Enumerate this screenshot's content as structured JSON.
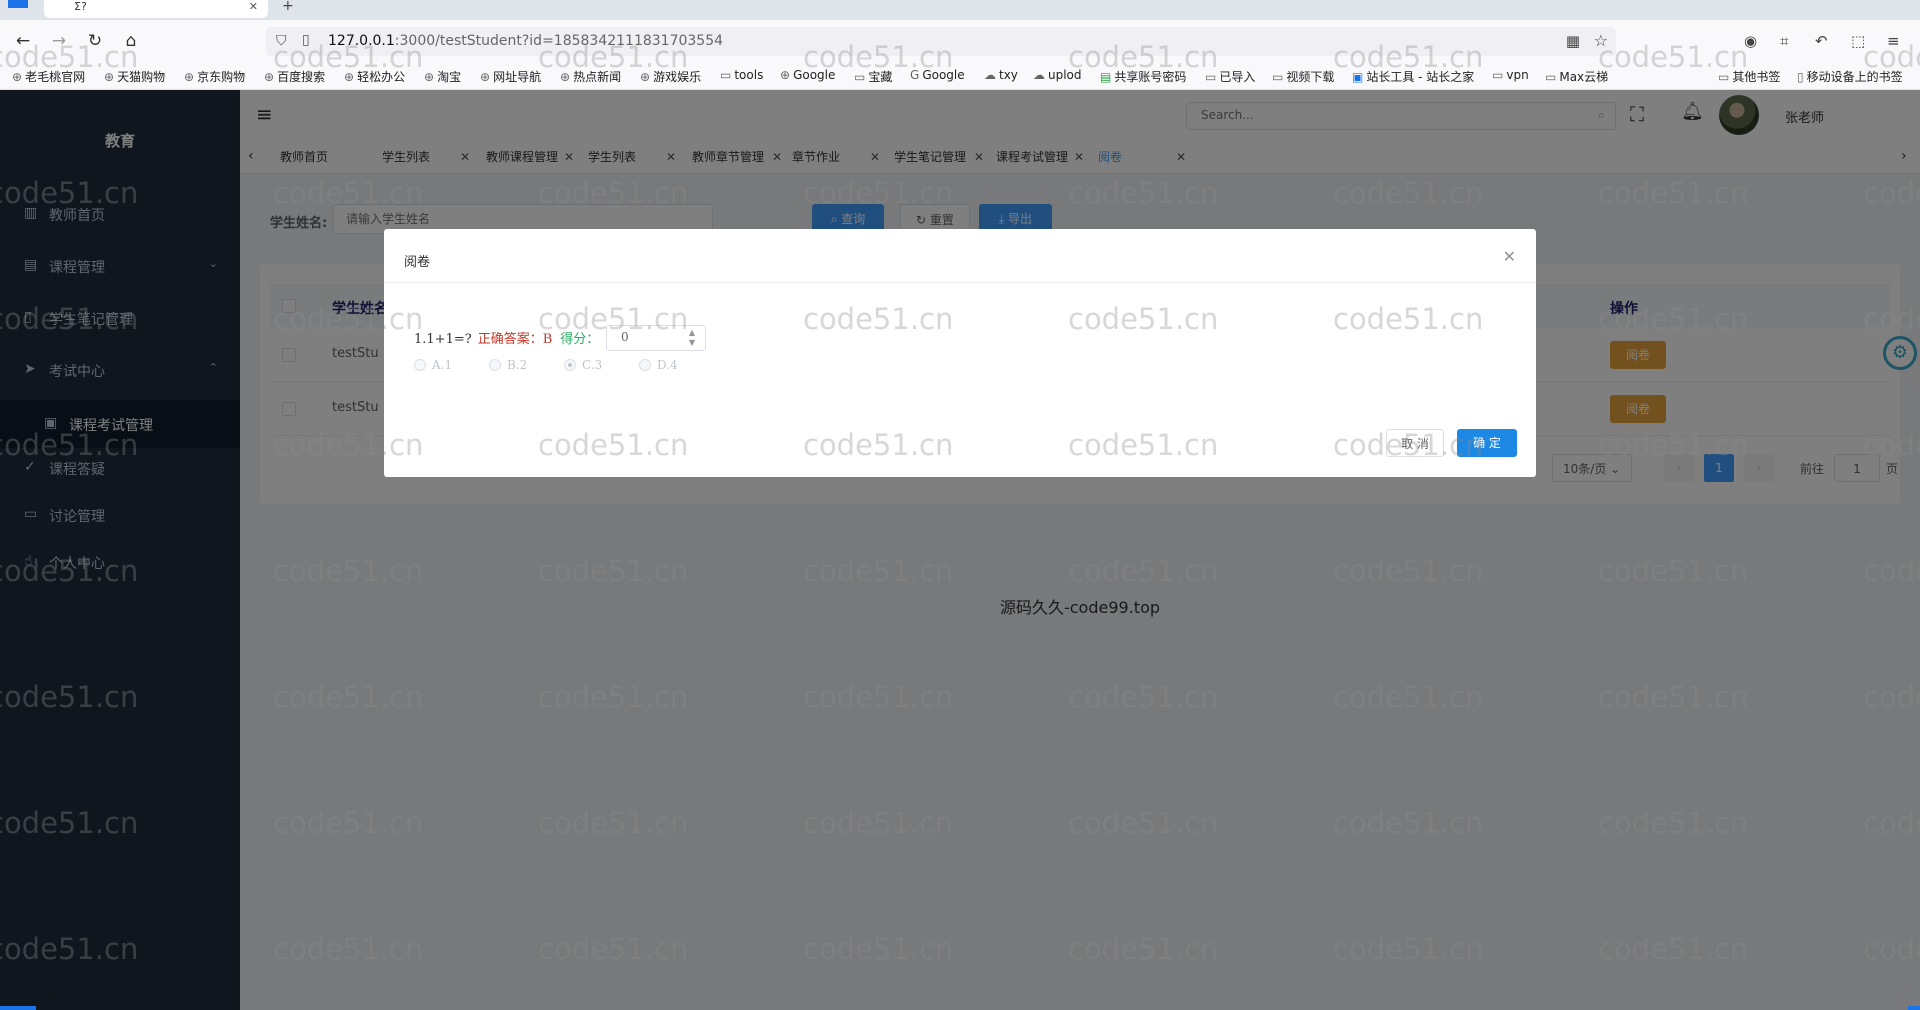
{
  "browser": {
    "tab_title": "Σ?",
    "url_host": "127.0.0.1",
    "url_path": ":3000/testStudent?id=1858342111831703554",
    "bookmarks": [
      "老毛桃官网",
      "天猫购物",
      "京东购物",
      "百度搜索",
      "轻松办公",
      "淘宝",
      "网址导航",
      "热点新闻",
      "游戏娱乐",
      "tools",
      "Google",
      "宝藏",
      "Google",
      "txy",
      "uplod",
      "共享账号密码",
      "已导入",
      "视频下载",
      "站长工具 - 站长之家",
      "vpn",
      "Max云梯",
      "其他书签",
      "移动设备上的书签"
    ]
  },
  "sidebar": {
    "brand": "教育",
    "items": [
      {
        "label": "教师首页"
      },
      {
        "label": "课程管理"
      },
      {
        "label": "学生笔记管理"
      },
      {
        "label": "考试中心"
      },
      {
        "label": "课程考试管理"
      },
      {
        "label": "课程答疑"
      },
      {
        "label": "讨论管理"
      },
      {
        "label": "个人中心"
      }
    ]
  },
  "topbar": {
    "search_placeholder": "Search...",
    "username": "张老师"
  },
  "tags": [
    "教师首页",
    "学生列表",
    "教师课程管理",
    "学生列表",
    "教师章节管理",
    "章节作业",
    "学生笔记管理",
    "课程考试管理",
    "阅卷"
  ],
  "filter": {
    "label": "学生姓名:",
    "placeholder": "请输入学生姓名",
    "query": "查询",
    "reset": "重置",
    "export": "导出"
  },
  "table": {
    "col_name": "学生姓名",
    "col_action": "操作",
    "rows": [
      {
        "name": "testStu",
        "action": "阅卷"
      },
      {
        "name": "testStu",
        "action": "阅卷"
      }
    ],
    "page_size": "10条/页",
    "current_page": "1",
    "goto_label": "前往",
    "goto_value": "1",
    "page_unit": "页"
  },
  "footer": "源码久久-code99.top",
  "modal": {
    "title": "阅卷",
    "question": "1.1+1=?",
    "correct": "正确答案：B",
    "score_label": "得分：",
    "score": "0",
    "options": [
      "A.1",
      "B.2",
      "C.3",
      "D.4"
    ],
    "selected_option": "C.3",
    "cancel": "取 消",
    "ok": "确 定"
  },
  "watermark": "code51.cn"
}
